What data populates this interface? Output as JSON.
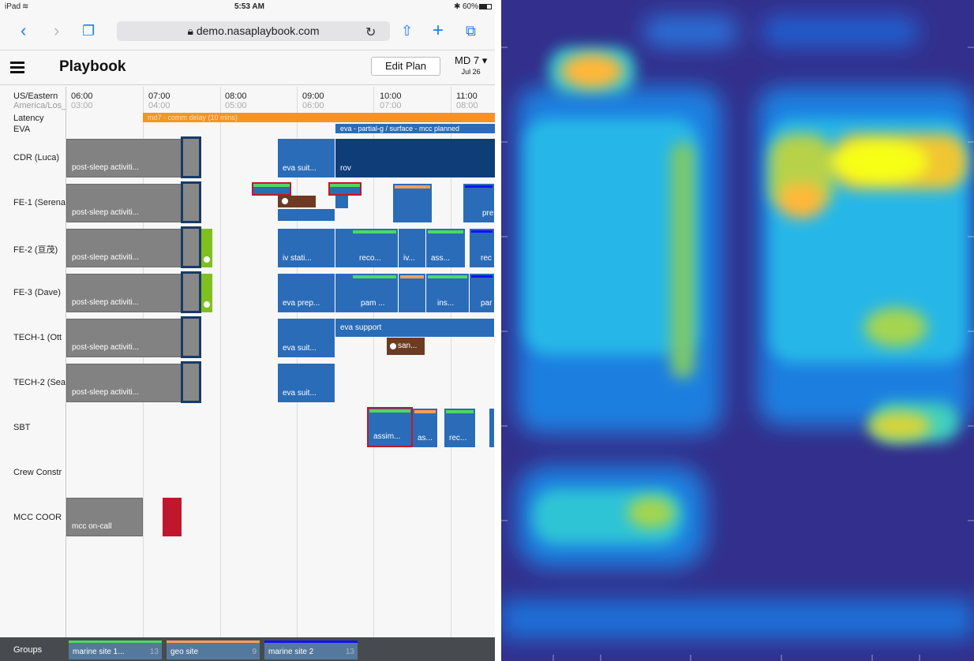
{
  "status_bar": {
    "device": "iPad",
    "time": "5:53 AM",
    "battery": "60%"
  },
  "browser": {
    "url": "demo.nasaplaybook.com"
  },
  "app": {
    "title": "Playbook",
    "edit_plan": "Edit Plan",
    "mission_day": "MD 7",
    "date": "Jul 26"
  },
  "timezones": {
    "primary": "US/Eastern",
    "secondary": "America/Los_A"
  },
  "times": [
    {
      "t": "06:00",
      "s": "03:00"
    },
    {
      "t": "07:00",
      "s": "04:00"
    },
    {
      "t": "08:00",
      "s": "05:00"
    },
    {
      "t": "09:00",
      "s": "06:00"
    },
    {
      "t": "10:00",
      "s": "07:00"
    },
    {
      "t": "11:00",
      "s": "08:00"
    }
  ],
  "rows": {
    "latency": "Latency",
    "eva": "EVA",
    "cdr": "CDR (Luca)",
    "fe1": "FE-1 (Serena",
    "fe2": "FE-2 (亘茂)",
    "fe3": "FE-3 (Dave)",
    "tech1": "TECH-1 (Ott",
    "tech2": "TECH-2 (Sea",
    "sbt": "SBT",
    "crew": "Crew Constr",
    "mcc": "MCC COOR"
  },
  "bars": {
    "latency": "md7 - comm delay (10 mins)",
    "eva": "eva - partial-g / surface - mcc planned"
  },
  "activities": {
    "post_sleep": "post-sleep activiti...",
    "eva_suit": "eva suit...",
    "rov": "rov",
    "pre": "pre",
    "iv_stati": "iv stati...",
    "reco": "reco...",
    "iv": "iv...",
    "ass": "ass...",
    "rec": "rec",
    "eva_prep": "eva prep...",
    "pam": "pam ...",
    "ins": "ins...",
    "par": "par",
    "eva_support": "eva support",
    "san": "san...",
    "assim": "assim...",
    "as": "as...",
    "rec2": "rec...",
    "mcc_oncall": "mcc on-call"
  },
  "groups": {
    "label": "Groups",
    "items": [
      {
        "name": "marine site 1...",
        "count": "13",
        "color": "#4cd964"
      },
      {
        "name": "geo site",
        "count": "9",
        "color": "#ff9f55"
      },
      {
        "name": "marine site 2",
        "count": "13",
        "color": "#1010ff"
      }
    ]
  },
  "colors": {
    "accent": "#1a7cf5",
    "activity": "#2a6cb8",
    "latency": "#f7941d",
    "alert": "#c0172c"
  }
}
